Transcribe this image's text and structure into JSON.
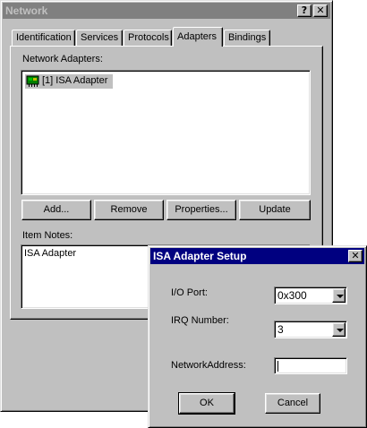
{
  "network_window": {
    "title": "Network",
    "help_button": "?",
    "close_button": "✕",
    "tabs": [
      {
        "label": "Identification",
        "active": false
      },
      {
        "label": "Services",
        "active": false
      },
      {
        "label": "Protocols",
        "active": false
      },
      {
        "label": "Adapters",
        "active": true
      },
      {
        "label": "Bindings",
        "active": false
      }
    ],
    "network_adapters_label": "Network Adapters:",
    "adapters": [
      {
        "label": "[1] ISA Adapter",
        "selected": true,
        "icon": "network-card-icon"
      }
    ],
    "buttons": {
      "add": "Add...",
      "remove": "Remove",
      "properties": "Properties...",
      "update": "Update"
    },
    "item_notes_label": "Item Notes:",
    "item_notes_value": "ISA Adapter"
  },
  "setup_dialog": {
    "title": "ISA Adapter Setup",
    "close_button": "✕",
    "io_port_label": "I/O Port:",
    "io_port_value": "0x300",
    "irq_label": "IRQ Number:",
    "irq_value": "3",
    "network_address_label": "NetworkAddress:",
    "network_address_value": "",
    "ok_label": "OK",
    "cancel_label": "Cancel"
  },
  "colors": {
    "face": "#c0c0c0",
    "active_title": "#000080",
    "inactive_title": "#808080",
    "selection": "#c0c0c0"
  }
}
